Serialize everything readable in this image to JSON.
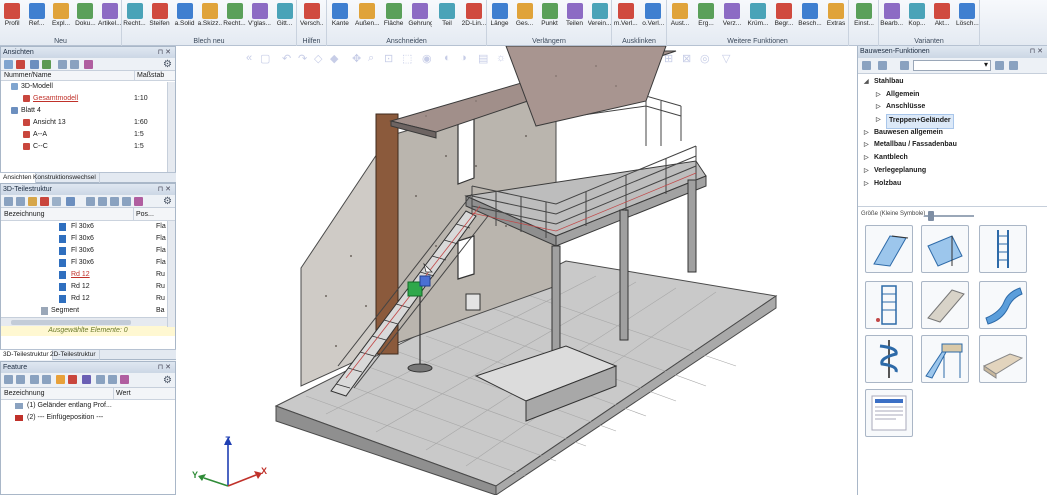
{
  "ribbon": {
    "groups": [
      {
        "label": "Neu",
        "buttons": [
          "Profil",
          "Ref...",
          "Expl...",
          "Doku...",
          "Artikel..."
        ]
      },
      {
        "label": "Blech neu",
        "buttons": [
          "Recht...",
          "Steifen",
          "a.Solid",
          "a.Skizz...",
          "Recht...",
          "V'glas...",
          "Gitt..."
        ]
      },
      {
        "label": "Hilfen",
        "buttons": [
          "Versch..."
        ]
      },
      {
        "label": "Anschneiden",
        "buttons": [
          "Kante",
          "Außen...",
          "Fläche",
          "Gehrung",
          "Teil",
          "2D-Lin..."
        ]
      },
      {
        "label": "Verlängern",
        "buttons": [
          "Länge",
          "Ges...",
          "Punkt",
          "Teilen",
          "Verein..."
        ]
      },
      {
        "label": "Ausklinken",
        "buttons": [
          "m.Verl...",
          "o.Verl..."
        ]
      },
      {
        "label": "Weitere Funktionen",
        "buttons": [
          "Aust...",
          "Erg...",
          "Verz...",
          "Krüm...",
          "Begr...",
          "Besch...",
          "Extras"
        ]
      },
      {
        "label": "",
        "buttons": [
          "Einst..."
        ]
      },
      {
        "label": "Varianten",
        "buttons": [
          "Bearb...",
          "Kop...",
          "Akt...",
          "Lösch..."
        ]
      }
    ]
  },
  "ansichten": {
    "title": "Ansichten",
    "col_name": "Nummer/Name",
    "col_scale": "Maßstab",
    "rows": [
      {
        "name": "3D-Modell",
        "scale": ""
      },
      {
        "name": "Gesamtmodell",
        "scale": "1:10"
      },
      {
        "name": "Blatt 4",
        "scale": ""
      },
      {
        "name": "Ansicht 13",
        "scale": "1:60"
      },
      {
        "name": "A--A",
        "scale": "1:5"
      },
      {
        "name": "C--C",
        "scale": "1:5"
      }
    ],
    "tabs": [
      "Ansichten",
      "Konstruktionswechsel"
    ]
  },
  "teilestruktur": {
    "title": "3D-Teilestruktur",
    "col_name": "Bezeichnung",
    "col_pos": "Pos...",
    "rows": [
      {
        "name": "Fl 30x6",
        "pos": "Fla"
      },
      {
        "name": "Fl 30x6",
        "pos": "Fla"
      },
      {
        "name": "Fl 30x6",
        "pos": "Fla"
      },
      {
        "name": "Fl 30x6",
        "pos": "Fla"
      },
      {
        "name": "Rd 12",
        "pos": "Ru"
      },
      {
        "name": "Rd 12",
        "pos": "Ru"
      },
      {
        "name": "Rd 12",
        "pos": "Ru"
      },
      {
        "name": "Segment",
        "pos": "Ba"
      }
    ],
    "status": "Ausgewählte Elemente: 0",
    "tabs": [
      "3D-Teilestruktur",
      "2D-Teilestruktur"
    ]
  },
  "feature": {
    "title": "Feature",
    "col_name": "Bezeichnung",
    "col_value": "Wert",
    "rows": [
      {
        "name": "(1) Geländer entlang Prof..."
      },
      {
        "name": "(2) --- Einfügeposition ---"
      }
    ]
  },
  "right_panel": {
    "title": "Bauwesen-Funktionen",
    "tree": [
      {
        "label": "Stahlbau",
        "level": 0,
        "open": true
      },
      {
        "label": "Allgemein",
        "level": 1
      },
      {
        "label": "Anschlüsse",
        "level": 1
      },
      {
        "label": "Treppen+Geländer",
        "level": 1,
        "selected": true
      },
      {
        "label": "Bauwesen allgemein",
        "level": 0
      },
      {
        "label": "Metallbau / Fassadenbau",
        "level": 0
      },
      {
        "label": "Kantblech",
        "level": 0
      },
      {
        "label": "Verlegeplanung",
        "level": 0
      },
      {
        "label": "Holzbau",
        "level": 0
      }
    ],
    "size_label": "Größe",
    "size_hint": "(Kleine Symbole)",
    "thumbnails": [
      "stair-landing-icon",
      "stair-straight-icon",
      "ladder-icon",
      "cage-ladder-icon",
      "stair-concrete-icon",
      "stair-winder-icon",
      "spiral-stair-icon",
      "platform-stair-icon",
      "stair-sofa-icon",
      "document-thumb-icon"
    ]
  },
  "axes": {
    "z": "Z",
    "x": "X",
    "y": "Y"
  },
  "colors": {
    "accent": "#1f5fb6",
    "panel_border": "#a9b7c8",
    "ribbon_bg": "#e4eaf2"
  }
}
